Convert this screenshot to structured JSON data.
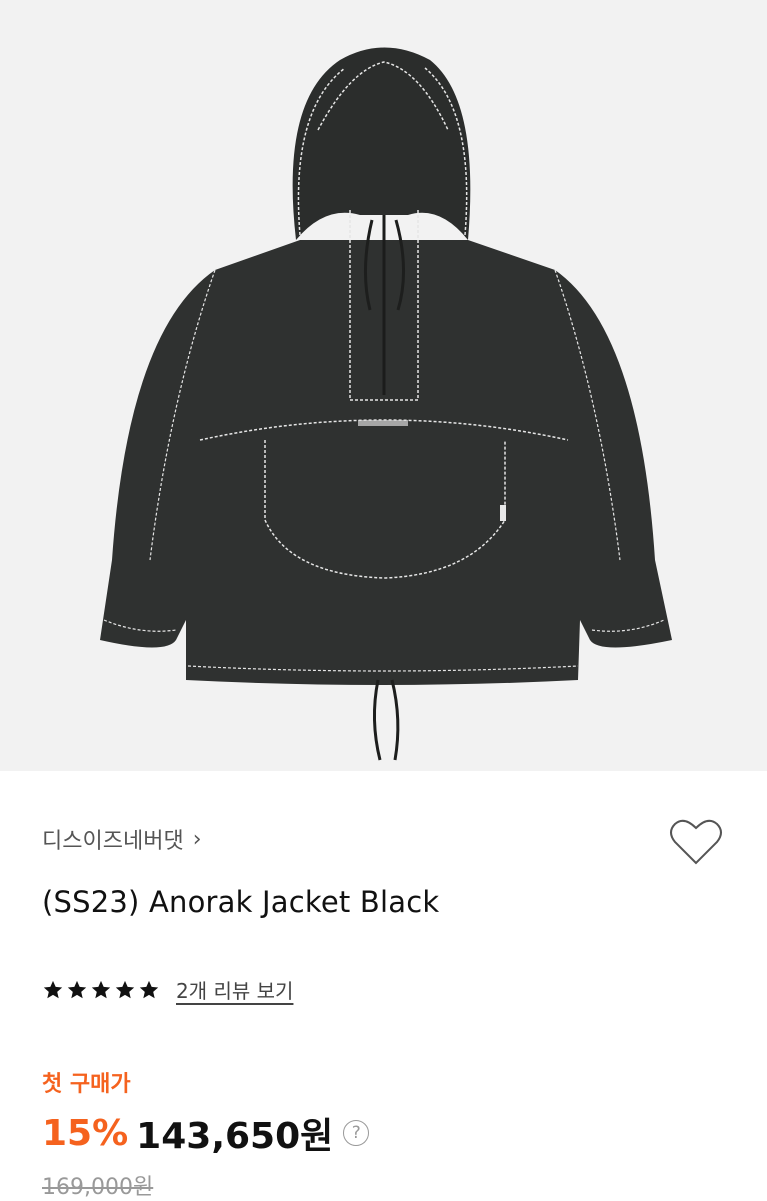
{
  "product": {
    "image_alt": "black anorak jacket with white contrast stitching",
    "brand": "디스이즈네버댓",
    "brand_chevron": "›",
    "title": "(SS23) Anorak Jacket Black",
    "rating": {
      "stars": 5,
      "review_link": "2개 리뷰 보기"
    },
    "price": {
      "first_purchase_label": "첫 구매가",
      "discount": "15%",
      "sale_price": "143,650원",
      "help": "?",
      "original_price": "169,000원"
    },
    "colors": {
      "accent": "#f5621e",
      "background_image": "#f2f2f2",
      "jacket": "#2e302f",
      "stitch": "#e6e6e6"
    },
    "icons": {
      "wishlist": "heart-outline-icon",
      "rating": "star-icon",
      "help": "question-circle-icon",
      "chevron": "chevron-right-icon"
    }
  }
}
